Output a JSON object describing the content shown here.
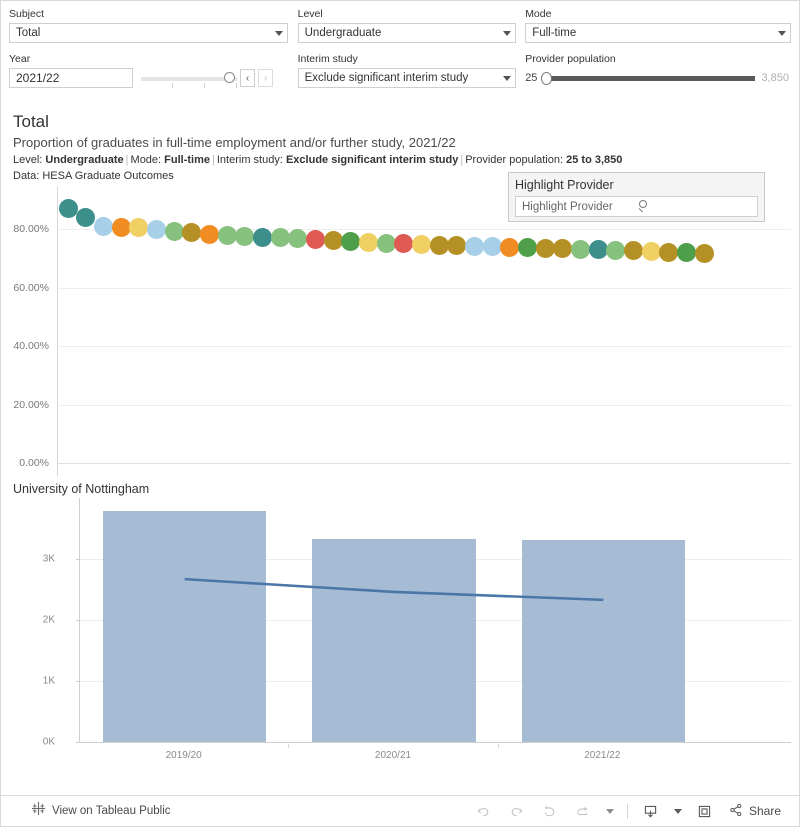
{
  "filters": {
    "subject": {
      "label": "Subject",
      "value": "Total"
    },
    "level": {
      "label": "Level",
      "value": "Undergraduate"
    },
    "mode": {
      "label": "Mode",
      "value": "Full-time"
    },
    "year": {
      "label": "Year",
      "value": "2021/22",
      "prev_label": "‹",
      "next_label": "›"
    },
    "interim_study": {
      "label": "Interim study",
      "value": "Exclude significant interim study"
    },
    "provider_population": {
      "label": "Provider population",
      "min": "25",
      "max": "3,850"
    }
  },
  "title": {
    "heading": "Total",
    "subtitle": "Proportion of graduates in full-time employment and/or further study, 2021/22",
    "meta": {
      "level_key": "Level:",
      "level_val": "Undergraduate",
      "mode_key": "Mode:",
      "mode_val": "Full-time",
      "interim_key": "Interim study:",
      "interim_val": "Exclude significant interim study",
      "pop_key": "Provider population:",
      "pop_val": "25 to 3,850"
    },
    "data_source": "Data: HESA Graduate Outcomes"
  },
  "highlight_panel": {
    "title": "Highlight Provider",
    "placeholder": "Highlight Provider",
    "search_icon": "search-icon"
  },
  "chart_data": [
    {
      "type": "scatter",
      "title": "Proportion of graduates in full-time employment and/or further study, 2021/22",
      "xlabel": "",
      "ylabel": "",
      "ylim": [
        0,
        90
      ],
      "yticks": [
        "0.00%",
        "20.00%",
        "40.00%",
        "60.00%",
        "80.00%"
      ],
      "ytick_values": [
        0,
        20,
        40,
        60,
        80
      ],
      "grid": true,
      "legend": "none",
      "note": "Providers ranked by proportion, descending. Colour encodes provider group.",
      "points": [
        {
          "x": 1,
          "y": 87.0,
          "color": "#3d8f8b"
        },
        {
          "x": 2,
          "y": 84.0,
          "color": "#3d8f8b"
        },
        {
          "x": 3,
          "y": 81.0,
          "color": "#a7cfe8"
        },
        {
          "x": 4,
          "y": 80.7,
          "color": "#f18c22"
        },
        {
          "x": 5,
          "y": 80.5,
          "color": "#f0cf63"
        },
        {
          "x": 6,
          "y": 80.0,
          "color": "#a7cfe8"
        },
        {
          "x": 7,
          "y": 79.3,
          "color": "#87c17e"
        },
        {
          "x": 8,
          "y": 78.8,
          "color": "#b59025"
        },
        {
          "x": 9,
          "y": 78.3,
          "color": "#f18c22"
        },
        {
          "x": 10,
          "y": 77.9,
          "color": "#87c17e"
        },
        {
          "x": 11,
          "y": 77.5,
          "color": "#87c17e"
        },
        {
          "x": 12,
          "y": 77.1,
          "color": "#3d8f8b"
        },
        {
          "x": 13,
          "y": 77.0,
          "color": "#87c17e"
        },
        {
          "x": 14,
          "y": 76.8,
          "color": "#87c17e"
        },
        {
          "x": 15,
          "y": 76.4,
          "color": "#e05a54"
        },
        {
          "x": 16,
          "y": 76.0,
          "color": "#b59025"
        },
        {
          "x": 17,
          "y": 75.8,
          "color": "#4f9e4a"
        },
        {
          "x": 18,
          "y": 75.5,
          "color": "#f0cf63"
        },
        {
          "x": 19,
          "y": 75.2,
          "color": "#87c17e"
        },
        {
          "x": 20,
          "y": 75.0,
          "color": "#e05a54"
        },
        {
          "x": 21,
          "y": 74.8,
          "color": "#f0cf63"
        },
        {
          "x": 22,
          "y": 74.5,
          "color": "#b59025"
        },
        {
          "x": 23,
          "y": 74.3,
          "color": "#b59025"
        },
        {
          "x": 24,
          "y": 74.1,
          "color": "#a7cfe8"
        },
        {
          "x": 25,
          "y": 74.0,
          "color": "#a7cfe8"
        },
        {
          "x": 26,
          "y": 73.8,
          "color": "#f18c22"
        },
        {
          "x": 27,
          "y": 73.6,
          "color": "#4f9e4a"
        },
        {
          "x": 28,
          "y": 73.5,
          "color": "#b59025"
        },
        {
          "x": 29,
          "y": 73.3,
          "color": "#b59025"
        },
        {
          "x": 30,
          "y": 73.1,
          "color": "#87c17e"
        },
        {
          "x": 31,
          "y": 73.0,
          "color": "#3d8f8b"
        },
        {
          "x": 32,
          "y": 72.8,
          "color": "#87c17e"
        },
        {
          "x": 33,
          "y": 72.6,
          "color": "#b59025"
        },
        {
          "x": 34,
          "y": 72.4,
          "color": "#f0cf63"
        },
        {
          "x": 35,
          "y": 72.2,
          "color": "#b59025"
        },
        {
          "x": 36,
          "y": 72.0,
          "color": "#4f9e4a"
        },
        {
          "x": 37,
          "y": 71.8,
          "color": "#b59025"
        }
      ]
    },
    {
      "type": "bar",
      "title": "University of Nottingham",
      "categories": [
        "2019/20",
        "2020/21",
        "2021/22"
      ],
      "values": [
        3780,
        3330,
        3310
      ],
      "bar_color": "#a6bcd5",
      "ylabel": "",
      "xlabel": "",
      "ylim": [
        0,
        4000
      ],
      "yticks": [
        "0K",
        "1K",
        "2K",
        "3K"
      ],
      "ytick_values": [
        0,
        1000,
        2000,
        3000
      ],
      "grid": true,
      "overlay_line": {
        "name": "trend",
        "color": "#4a77a8",
        "values": [
          2670,
          2460,
          2330
        ]
      }
    }
  ],
  "toolbar": {
    "view_on_label": "View on Tableau Public",
    "tableau_icon": "tableau-logo-icon",
    "undo_icon": "undo-icon",
    "redo_icon": "redo-icon",
    "revert_icon": "revert-icon",
    "refresh_icon": "refresh-icon",
    "refresh_caret_icon": "chevron-down-icon",
    "download_icon": "download-icon",
    "download_caret_icon": "chevron-down-icon",
    "fullscreen_icon": "fullscreen-icon",
    "share_icon": "share-icon",
    "share_label": "Share"
  }
}
